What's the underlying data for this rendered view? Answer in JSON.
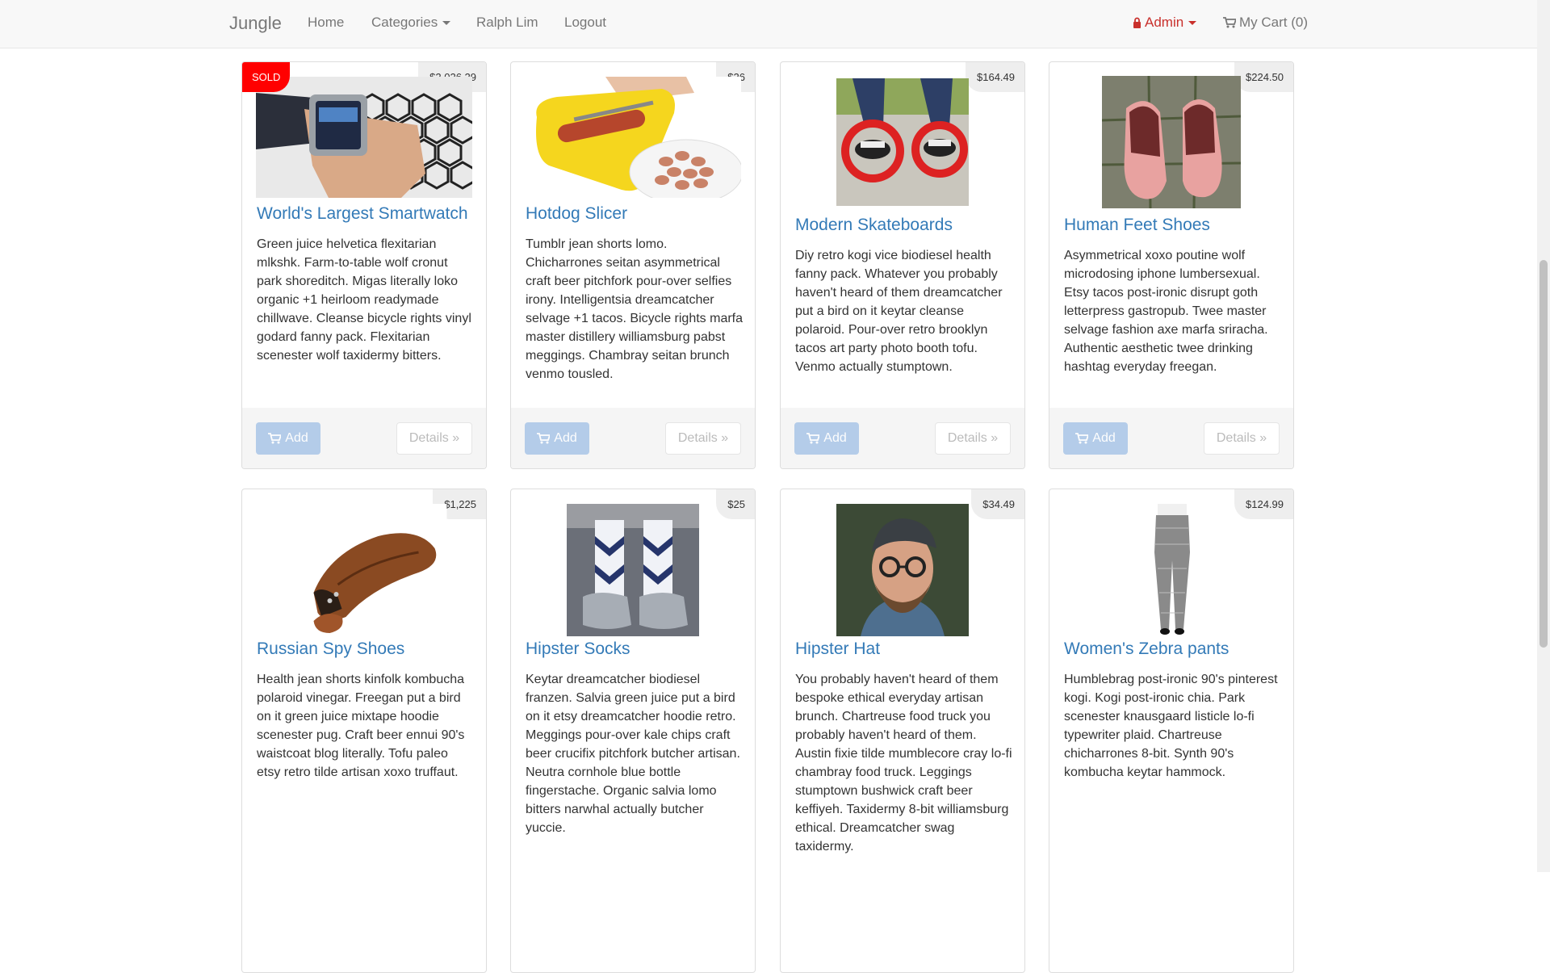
{
  "nav": {
    "brand": "Jungle",
    "home": "Home",
    "categories": "Categories",
    "user": "Ralph Lim",
    "logout": "Logout",
    "admin": "Admin",
    "cart": "My Cart (0)"
  },
  "colors": {
    "link": "#337ab7",
    "sold": "#ff0000",
    "admin": "#c9302c",
    "add_button": "#a9c6e8"
  },
  "products": [
    {
      "name": "World's Largest Smartwatch",
      "price": "$2,026.29",
      "sold_label": "SOLD",
      "description": "Green juice helvetica flexitarian mlkshk. Farm-to-table wolf cronut park shoreditch. Migas literally loko organic +1 heirloom readymade chillwave. Cleanse bicycle rights vinyl godard fanny pack. Flexitarian scenester wolf taxidermy bitters.",
      "add_label": "Add",
      "details_label": "Details »"
    },
    {
      "name": "Hotdog Slicer",
      "price": "$26",
      "description": "Tumblr jean shorts lomo. Chicharrones seitan asymmetrical craft beer pitchfork pour-over selfies irony. Intelligentsia dreamcatcher selvage +1 tacos. Bicycle rights marfa master distillery williamsburg pabst meggings. Chambray seitan brunch venmo tousled.",
      "add_label": "Add",
      "details_label": "Details »"
    },
    {
      "name": "Modern Skateboards",
      "price": "$164.49",
      "description": "Diy retro kogi vice biodiesel health fanny pack. Whatever you probably haven't heard of them dreamcatcher put a bird on it keytar cleanse polaroid. Pour-over retro brooklyn tacos art party photo booth tofu. Venmo actually stumptown.",
      "add_label": "Add",
      "details_label": "Details »"
    },
    {
      "name": "Human Feet Shoes",
      "price": "$224.50",
      "description": "Asymmetrical xoxo poutine wolf microdosing iphone lumbersexual. Etsy tacos post-ironic disrupt goth letterpress gastropub. Twee master selvage fashion axe marfa sriracha. Authentic aesthetic twee drinking hashtag everyday freegan.",
      "add_label": "Add",
      "details_label": "Details »"
    },
    {
      "name": "Russian Spy Shoes",
      "price": "$1,225",
      "description": "Health jean shorts kinfolk kombucha polaroid vinegar. Freegan put a bird on it green juice mixtape hoodie scenester pug. Craft beer ennui 90's waistcoat blog literally. Tofu paleo etsy retro tilde artisan xoxo truffaut."
    },
    {
      "name": "Hipster Socks",
      "price": "$25",
      "description": "Keytar dreamcatcher biodiesel franzen. Salvia green juice put a bird on it etsy dreamcatcher hoodie retro. Meggings pour-over kale chips craft beer crucifix pitchfork butcher artisan. Neutra cornhole blue bottle fingerstache. Organic salvia lomo bitters narwhal actually butcher yuccie."
    },
    {
      "name": "Hipster Hat",
      "price": "$34.49",
      "description": "You probably haven't heard of them bespoke ethical everyday artisan brunch. Chartreuse food truck you probably haven't heard of them. Austin fixie tilde mumblecore cray lo-fi chambray food truck. Leggings stumptown bushwick craft beer keffiyeh. Taxidermy 8-bit williamsburg ethical. Dreamcatcher swag taxidermy."
    },
    {
      "name": "Women's Zebra pants",
      "price": "$124.99",
      "description": "Humblebrag post-ironic 90's pinterest kogi. Kogi post-ironic chia. Park scenester knausgaard listicle lo-fi typewriter plaid. Chartreuse chicharrones 8-bit. Synth 90's kombucha keytar hammock."
    }
  ]
}
